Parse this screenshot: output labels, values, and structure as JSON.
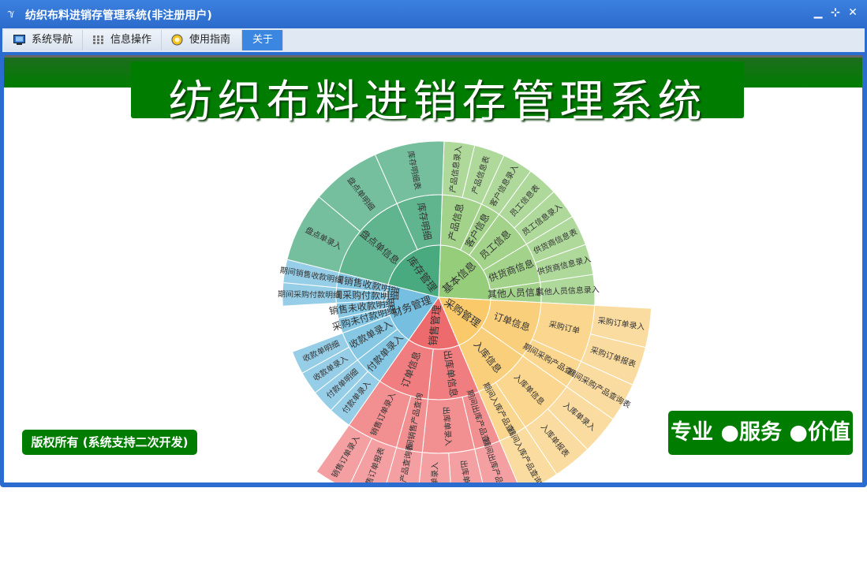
{
  "window": {
    "title": "纺织布料进销存管理系统(非注册用户)",
    "app_icon": "app-logo-icon",
    "minimize_icon": "minimize-icon",
    "restore_icon": "restore-icon",
    "close_icon": "close-icon"
  },
  "menu": {
    "tabs": [
      {
        "label": "系统导航",
        "icon": "monitor-icon"
      },
      {
        "label": "信息操作",
        "icon": "grid-icon"
      },
      {
        "label": "使用指南",
        "icon": "help-icon"
      },
      {
        "label": "关于",
        "icon": ""
      }
    ],
    "active_tab": "关于"
  },
  "banner": {
    "title": "纺织布料进销存管理系统"
  },
  "copyright": "版权所有 (系统支持二次开发)",
  "slogan": "专业 ●服务 ●价值",
  "colors": {
    "brand_green": "#007d00",
    "titlebar_blue": "#2a6ccf",
    "basic_info": "#96cd7b",
    "purchase": "#f9c96a",
    "sales": "#ee6b6d",
    "finance": "#76bfe0",
    "inventory": "#4aaa7f"
  },
  "chart_data": {
    "type": "sunburst",
    "modules": [
      {
        "name": "基本信息",
        "children": [
          {
            "name": "产品信息",
            "children": [
              {
                "name": "产品信息录入"
              },
              {
                "name": "产品信息表"
              }
            ]
          },
          {
            "name": "客户信息",
            "children": [
              {
                "name": "客户信息录入"
              }
            ]
          },
          {
            "name": "员工信息",
            "children": [
              {
                "name": "员工信息表"
              },
              {
                "name": "员工信息录入"
              }
            ]
          },
          {
            "name": "供货商信息",
            "children": [
              {
                "name": "供货商信息表"
              },
              {
                "name": "供货商信息录入"
              }
            ]
          },
          {
            "name": "其他人员信息",
            "children": [
              {
                "name": "其他人员信息录入"
              }
            ]
          }
        ]
      },
      {
        "name": "采购管理",
        "children": [
          {
            "name": "订单信息",
            "children": [
              {
                "name": "采购订单",
                "children": [
                  {
                    "name": "采购订单录入"
                  },
                  {
                    "name": "采购订单报表"
                  }
                ]
              },
              {
                "name": "期间采购产品查询",
                "children": [
                  {
                    "name": "期间采购产品查询表"
                  }
                ]
              }
            ]
          },
          {
            "name": "入库信息",
            "children": [
              {
                "name": "入库单信息",
                "children": [
                  {
                    "name": "入库单录入"
                  },
                  {
                    "name": "入库单报表"
                  }
                ]
              },
              {
                "name": "期间入库产品查询",
                "children": [
                  {
                    "name": "期间入库产品查询表"
                  }
                ]
              }
            ]
          }
        ]
      },
      {
        "name": "销售管理",
        "children": [
          {
            "name": "出库单信息",
            "children": [
              {
                "name": "期间出库产品查询",
                "children": [
                  {
                    "name": "期间出库产品查询表"
                  }
                ]
              },
              {
                "name": "出库单录入",
                "children": [
                  {
                    "name": "出库单报表"
                  },
                  {
                    "name": "出库单录入"
                  }
                ]
              }
            ]
          },
          {
            "name": "订单信息",
            "children": [
              {
                "name": "期间销售产品查询",
                "children": [
                  {
                    "name": "期间销售产品查询表"
                  }
                ]
              },
              {
                "name": "销售订单录入",
                "children": [
                  {
                    "name": "销售订单报表"
                  },
                  {
                    "name": "销售订单录入"
                  }
                ]
              }
            ]
          }
        ]
      },
      {
        "name": "财务管理",
        "children": [
          {
            "name": "付款单录入",
            "children": [
              {
                "name": "付款单录入"
              },
              {
                "name": "付款单明细"
              }
            ]
          },
          {
            "name": "收款单录入",
            "children": [
              {
                "name": "收款单录入"
              },
              {
                "name": "收款单明细"
              }
            ]
          },
          {
            "name": "采购未付款明细",
            "children": []
          },
          {
            "name": "销售未收款明细",
            "children": []
          },
          {
            "name": "期间采购付款明细",
            "children": [
              {
                "name": "期间采购付款明细"
              }
            ]
          },
          {
            "name": "期间销售收款明细",
            "children": [
              {
                "name": "期间销售收款明细"
              }
            ]
          }
        ]
      },
      {
        "name": "库存管理",
        "children": [
          {
            "name": "盘点单信息",
            "children": [
              {
                "name": "盘点单录入"
              },
              {
                "name": "盘点单明细"
              }
            ]
          },
          {
            "name": "库存明细",
            "children": [
              {
                "name": "库存明细表"
              }
            ]
          }
        ]
      }
    ]
  }
}
